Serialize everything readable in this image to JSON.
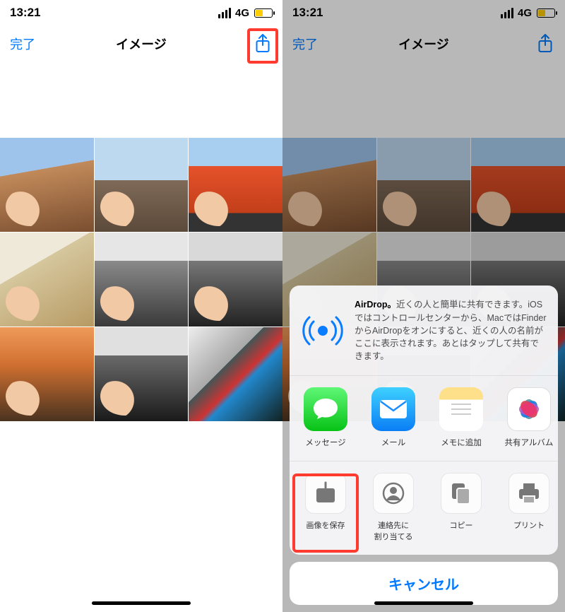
{
  "status": {
    "time": "13:21",
    "network": "4G"
  },
  "nav": {
    "done": "完了",
    "title": "イメージ"
  },
  "airdrop": {
    "title": "AirDrop。",
    "body": "近くの人と簡単に共有できます。iOSではコントロールセンターから、MacではFinderからAirDropをオンにすると、近くの人の名前がここに表示されます。あとはタップして共有できます。"
  },
  "apps": [
    {
      "id": "messages",
      "label": "メッセージ"
    },
    {
      "id": "mail",
      "label": "メール"
    },
    {
      "id": "notes",
      "label": "メモに追加"
    },
    {
      "id": "shared-album",
      "label": "共有アルバム"
    }
  ],
  "actions": [
    {
      "id": "save-image",
      "label": "画像を保存"
    },
    {
      "id": "assign-contact",
      "label": "連絡先に\n割り当てる"
    },
    {
      "id": "copy",
      "label": "コピー"
    },
    {
      "id": "print",
      "label": "プリント"
    }
  ],
  "cancel": "キャンセル"
}
